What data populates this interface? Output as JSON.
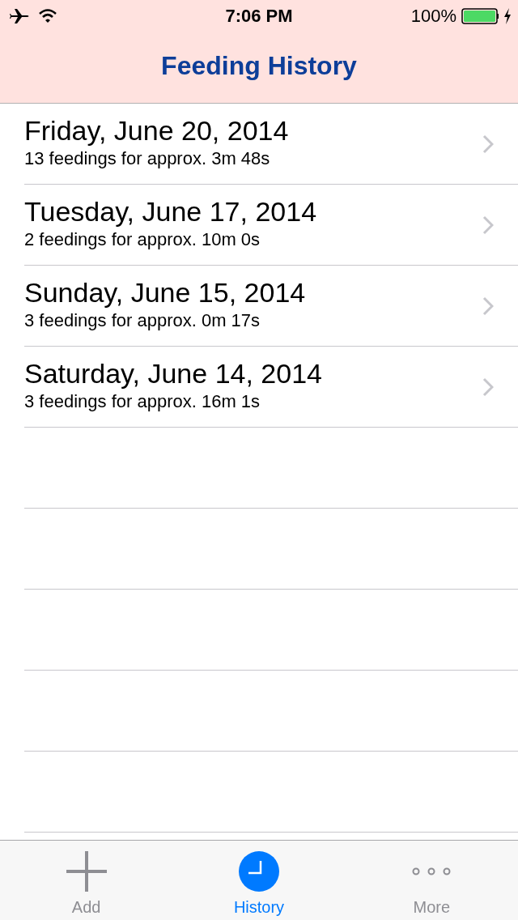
{
  "status_bar": {
    "time": "7:06 PM",
    "battery": "100%"
  },
  "nav_bar": {
    "title": "Feeding History"
  },
  "days": [
    {
      "date": "Friday, June 20, 2014",
      "summary": "13 feedings for approx. 3m 48s"
    },
    {
      "date": "Tuesday, June 17, 2014",
      "summary": "2 feedings for approx. 10m 0s"
    },
    {
      "date": "Sunday, June 15, 2014",
      "summary": "3 feedings for approx. 0m 17s"
    },
    {
      "date": "Saturday, June 14, 2014",
      "summary": "3 feedings for approx. 16m 1s"
    }
  ],
  "tabs": [
    {
      "kind": "add",
      "label": "Add",
      "selected": false
    },
    {
      "kind": "history",
      "label": "History",
      "selected": true
    },
    {
      "kind": "more",
      "label": "More",
      "selected": false
    }
  ]
}
